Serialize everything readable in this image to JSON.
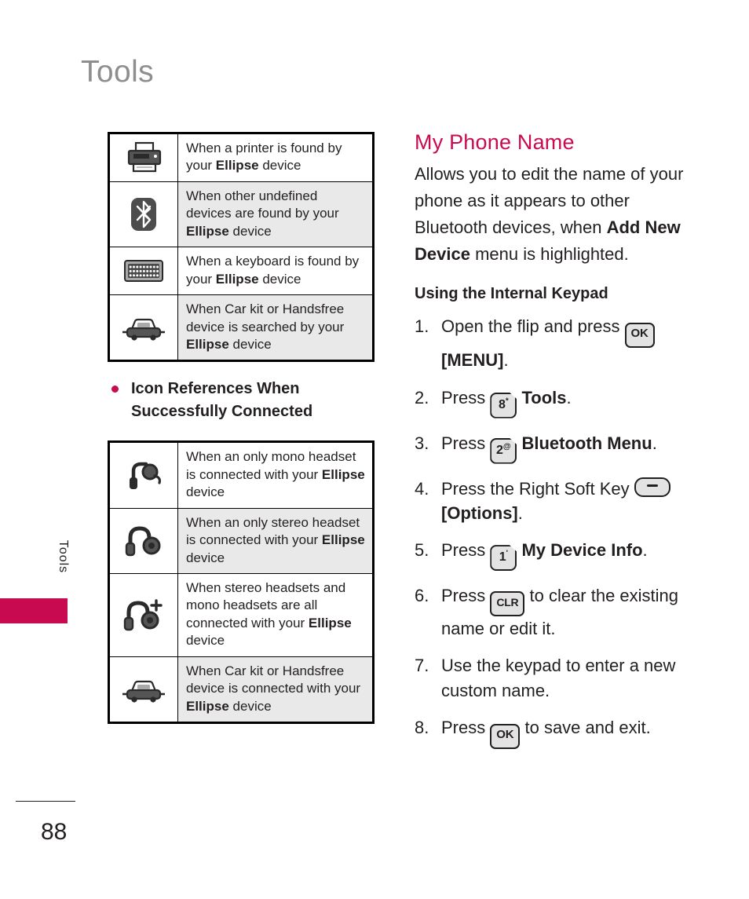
{
  "page": {
    "title": "Tools",
    "side_tab_label": "Tools",
    "page_number": "88",
    "accent_color": "#c80b51",
    "title_color": "#8e8e8e"
  },
  "found_table": {
    "rows": [
      {
        "icon": "printer-icon",
        "text_prefix": "When a printer is found by your ",
        "text_bold": "Ellipse",
        "text_suffix": " device",
        "shaded": false
      },
      {
        "icon": "bluetooth-icon",
        "text_prefix": "When other undefined devices are found by your ",
        "text_bold": "Ellipse",
        "text_suffix": " device",
        "shaded": true
      },
      {
        "icon": "keyboard-icon",
        "text_prefix": "When a keyboard is found by your ",
        "text_bold": "Ellipse",
        "text_suffix": " device",
        "shaded": false
      },
      {
        "icon": "car-icon",
        "text_prefix": "When Car kit or Handsfree device is searched by your ",
        "text_bold": "Ellipse",
        "text_suffix": " device",
        "shaded": true
      }
    ]
  },
  "bullet": {
    "label": "Icon References When Successfully Connected"
  },
  "connected_table": {
    "rows": [
      {
        "icon": "mono-headset-icon",
        "text_prefix": "When an only mono headset is connected with your ",
        "text_bold": "Ellipse",
        "text_suffix": " device",
        "shaded": false
      },
      {
        "icon": "stereo-headset-icon",
        "text_prefix": "When an only stereo headset is connected with your ",
        "text_bold": "Ellipse",
        "text_suffix": " device",
        "shaded": true
      },
      {
        "icon": "stereo-mono-headset-icon",
        "text_prefix": "When stereo headsets and mono headsets are all connected with your ",
        "text_bold": "Ellipse",
        "text_suffix": " device",
        "shaded": false
      },
      {
        "icon": "car-icon",
        "text_prefix": "When Car kit or Handsfree device is connected with your ",
        "text_bold": "Ellipse",
        "text_suffix": " device",
        "shaded": true
      }
    ]
  },
  "section": {
    "heading": "My Phone Name",
    "intro_part1": "Allows you to edit the name of your phone as it appears to other Bluetooth devices, when ",
    "intro_bold": "Add New Device",
    "intro_part2": " menu is highlighted.",
    "subheading": "Using the Internal Keypad"
  },
  "steps": [
    {
      "num": "1.",
      "pre": "Open the flip and press ",
      "key": "OK",
      "key_type": "ok",
      "key_name": "ok-key-icon",
      "post_bold": "[MENU]",
      "post": "."
    },
    {
      "num": "2.",
      "pre": "Press ",
      "key": "8",
      "key_sup": "*",
      "key_type": "num",
      "key_name": "key-8-icon",
      "post_bold": "Tools",
      "post": "."
    },
    {
      "num": "3.",
      "pre": "Press ",
      "key": "2",
      "key_sup": "@",
      "key_type": "num",
      "key_name": "key-2-icon",
      "post_bold": "Bluetooth Menu",
      "post": "."
    },
    {
      "num": "4.",
      "pre": "Press the Right Soft Key ",
      "key": "",
      "key_type": "soft",
      "key_name": "right-soft-key-icon",
      "post_bold": "[Options]",
      "post": "."
    },
    {
      "num": "5.",
      "pre": "Press ",
      "key": "1",
      "key_sup": "'",
      "key_type": "num",
      "key_name": "key-1-icon",
      "post_bold": "My Device Info",
      "post": "."
    },
    {
      "num": "6.",
      "pre": "Press ",
      "key": "CLR",
      "key_type": "clr",
      "key_name": "clr-key-icon",
      "post_bold": "",
      "post": " to clear the existing name or edit it."
    },
    {
      "num": "7.",
      "pre": "Use the keypad to enter a new custom name.",
      "key": "",
      "key_type": "none",
      "key_name": "",
      "post_bold": "",
      "post": ""
    },
    {
      "num": "8.",
      "pre": "Press ",
      "key": "OK",
      "key_type": "ok",
      "key_name": "ok-key-icon",
      "post_bold": "",
      "post": " to save and exit."
    }
  ]
}
